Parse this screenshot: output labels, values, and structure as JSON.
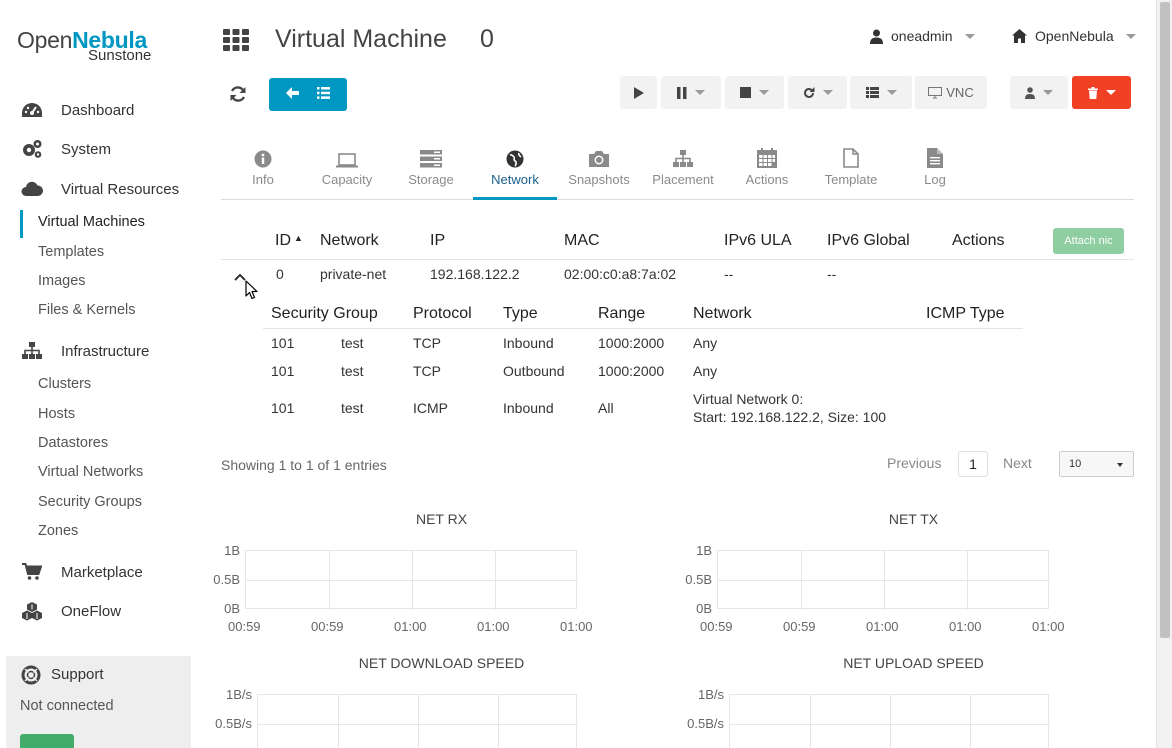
{
  "brand": {
    "name_a": "Open",
    "name_b": "Nebula",
    "sub": "Sunstone"
  },
  "sidebar": {
    "items": [
      {
        "label": "Dashboard",
        "icon": "dashboard-icon"
      },
      {
        "label": "System",
        "icon": "cogs-icon"
      },
      {
        "label": "Virtual Resources",
        "icon": "cloud-icon"
      },
      {
        "label": "Infrastructure",
        "icon": "sitemap-icon"
      },
      {
        "label": "Marketplace",
        "icon": "shopping-cart-icon"
      },
      {
        "label": "OneFlow",
        "icon": "cubes-icon"
      }
    ],
    "virtual_sub": [
      "Virtual Machines",
      "Templates",
      "Images",
      "Files & Kernels"
    ],
    "infra_sub": [
      "Clusters",
      "Hosts",
      "Datastores",
      "Virtual Networks",
      "Security Groups",
      "Zones"
    ],
    "support": {
      "title": "Support",
      "status": "Not connected"
    }
  },
  "header": {
    "title": "Virtual Machine",
    "vm_id": "0",
    "user": "oneadmin",
    "zone": "OpenNebula",
    "vnc": "VNC"
  },
  "tabs": [
    {
      "label": "Info",
      "icon": "info-circle-icon"
    },
    {
      "label": "Capacity",
      "icon": "laptop-icon"
    },
    {
      "label": "Storage",
      "icon": "tasks-icon"
    },
    {
      "label": "Network",
      "icon": "globe-icon",
      "active": true
    },
    {
      "label": "Snapshots",
      "icon": "camera-icon"
    },
    {
      "label": "Placement",
      "icon": "sitemap-icon"
    },
    {
      "label": "Actions",
      "icon": "calendar-icon"
    },
    {
      "label": "Template",
      "icon": "file-icon"
    },
    {
      "label": "Log",
      "icon": "file-text-icon"
    }
  ],
  "nic_table": {
    "headers": [
      "ID",
      "Network",
      "IP",
      "MAC",
      "IPv6 ULA",
      "IPv6 Global",
      "Actions"
    ],
    "attach_label": "Attach nic",
    "row": {
      "id": "0",
      "network": "private-net",
      "ip": "192.168.122.2",
      "mac": "02:00:c0:a8:7a:02",
      "ula": "--",
      "global": "--"
    }
  },
  "sg_table": {
    "headers": [
      "Security Group",
      "Protocol",
      "Type",
      "Range",
      "Network",
      "ICMP Type"
    ],
    "rows": [
      {
        "id": "101",
        "name": "test",
        "protocol": "TCP",
        "type": "Inbound",
        "range": "1000:2000",
        "network": "Any",
        "network2": ""
      },
      {
        "id": "101",
        "name": "test",
        "protocol": "TCP",
        "type": "Outbound",
        "range": "1000:2000",
        "network": "Any",
        "network2": ""
      },
      {
        "id": "101",
        "name": "test",
        "protocol": "ICMP",
        "type": "Inbound",
        "range": "All",
        "network": "Virtual Network 0:",
        "network2": "Start: 192.168.122.2, Size: 100"
      }
    ]
  },
  "pager": {
    "info": "Showing 1 to 1 of 1 entries",
    "previous": "Previous",
    "page": "1",
    "next": "Next",
    "page_size": "10"
  },
  "chart_data": [
    {
      "type": "line",
      "title": "NET RX",
      "y_ticks": [
        "1B",
        "0.5B",
        "0B"
      ],
      "x_ticks": [
        "00:59",
        "00:59",
        "01:00",
        "01:00",
        "01:00"
      ],
      "series": []
    },
    {
      "type": "line",
      "title": "NET TX",
      "y_ticks": [
        "1B",
        "0.5B",
        "0B"
      ],
      "x_ticks": [
        "00:59",
        "00:59",
        "01:00",
        "01:00",
        "01:00"
      ],
      "series": []
    },
    {
      "type": "line",
      "title": "NET DOWNLOAD SPEED",
      "y_ticks": [
        "1B/s",
        "0.5B/s"
      ],
      "x_ticks": [],
      "series": []
    },
    {
      "type": "line",
      "title": "NET UPLOAD SPEED",
      "y_ticks": [
        "1B/s",
        "0.5B/s"
      ],
      "x_ticks": [],
      "series": []
    }
  ]
}
